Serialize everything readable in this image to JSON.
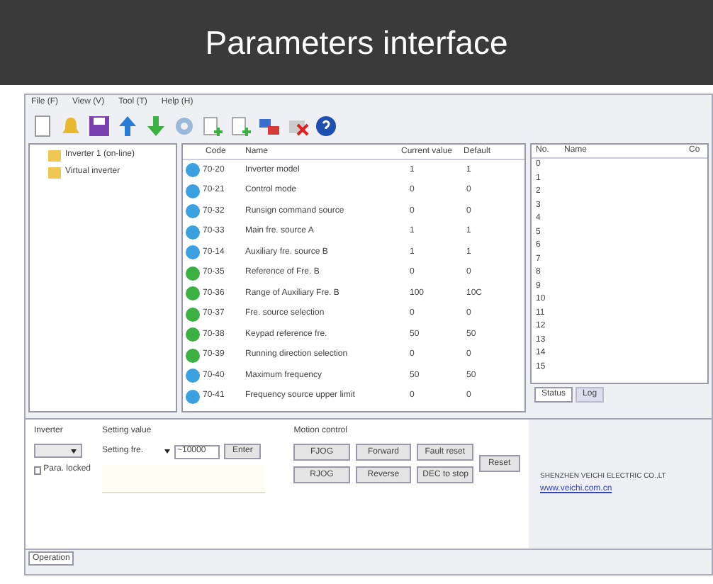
{
  "banner": {
    "title": "Parameters interface"
  },
  "menu": [
    "File (F)",
    "View (V)",
    "Tool (T)",
    "Help (H)"
  ],
  "tree": [
    {
      "label": "Inverter 1 (on-line)"
    },
    {
      "label": "Virtual inverter"
    }
  ],
  "params": {
    "columns": [
      "Code",
      "Name",
      "Current value",
      "Default"
    ],
    "rows": [
      {
        "code": "70-20",
        "name": "Inverter model",
        "current": "1",
        "default": "1",
        "color": "#3aa0e0"
      },
      {
        "code": "70-21",
        "name": "Control mode",
        "current": "0",
        "default": "0",
        "color": "#3aa0e0"
      },
      {
        "code": "70-32",
        "name": "Runsign command source",
        "current": "0",
        "default": "0",
        "color": "#3aa0e0"
      },
      {
        "code": "70-33",
        "name": "Main fre. source A",
        "current": "1",
        "default": "1",
        "color": "#3aa0e0"
      },
      {
        "code": "70-14",
        "name": "Auxiliary fre. source B",
        "current": "1",
        "default": "1",
        "color": "#3aa0e0"
      },
      {
        "code": "70-35",
        "name": "Reference of Fre. B",
        "current": "0",
        "default": "0",
        "color": "#3cb043"
      },
      {
        "code": "70-36",
        "name": "Range of Auxiliary Fre. B",
        "current": "100",
        "default": "10C",
        "color": "#3cb043"
      },
      {
        "code": "70-37",
        "name": "Fre. source selection",
        "current": "0",
        "default": "0",
        "color": "#3cb043"
      },
      {
        "code": "70-38",
        "name": "Keypad reference fre.",
        "current": "50",
        "default": "50",
        "color": "#3cb043"
      },
      {
        "code": "70-39",
        "name": "Running direction selection",
        "current": "0",
        "default": "0",
        "color": "#3cb043"
      },
      {
        "code": "70-40",
        "name": "Maximum frequency",
        "current": "50",
        "default": "50",
        "color": "#3aa0e0"
      },
      {
        "code": "70-41",
        "name": "Frequency source upper limit",
        "current": "0",
        "default": "0",
        "color": "#3aa0e0"
      }
    ]
  },
  "monitor": {
    "columns": [
      "No.",
      "Name",
      "Co"
    ],
    "rows": [
      "0",
      "1",
      "2",
      "3",
      "4",
      "5",
      "6",
      "7",
      "8",
      "9",
      "10",
      "11",
      "12",
      "13",
      "14",
      "15"
    ],
    "tabs": [
      {
        "label": "Status",
        "selected": true
      },
      {
        "label": "Log",
        "selected": false
      }
    ]
  },
  "inverter_group": {
    "title": "Inverter",
    "checkbox": {
      "label": "Para. locked",
      "checked": false
    }
  },
  "setting_group": {
    "title": "Setting value",
    "select": "Setting fre.",
    "spin": "~10000",
    "button": "Enter"
  },
  "motion_group": {
    "title": "Motion control",
    "buttons": [
      "FJOG",
      "Forward",
      "Fault reset",
      "RJOG",
      "Reverse",
      "DEC to stop"
    ]
  },
  "reset_button": "Reset",
  "company": {
    "name": "SHENZHEN VEICHI ELECTRIC CO.,LT",
    "link": "www.veichi.com.cn"
  },
  "status_bar": {
    "tab": "Operation"
  }
}
